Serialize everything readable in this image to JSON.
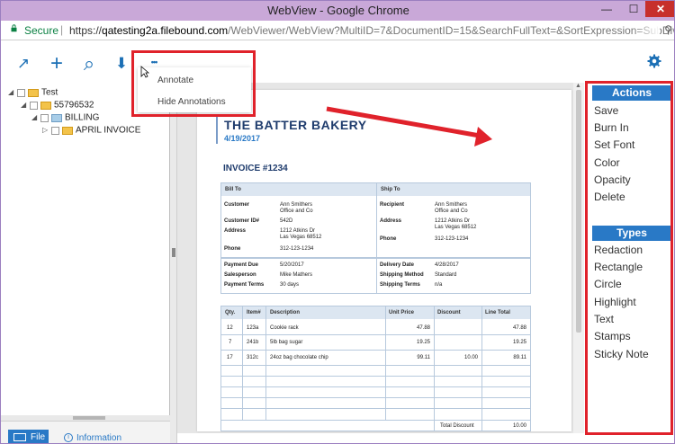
{
  "window": {
    "title": "WebView - Google Chrome",
    "controls": {
      "minimize": "—",
      "maximize": "☐",
      "close": "✕"
    }
  },
  "address_bar": {
    "secure_label": "Secure",
    "separator": "|",
    "url_scheme": "https://",
    "url_host": "qatesting2a.filebound.com",
    "url_path": "/WebViewer/WebView?MultiID=7&DocumentID=15&SearchFullText=&SortExpression=SubDivic"
  },
  "toolbar": {
    "icons": [
      "share-icon",
      "add-icon",
      "search-icon",
      "download-icon",
      "more-icon",
      "gear-icon"
    ],
    "glyphs": {
      "share": "↗",
      "add": "+",
      "search": "⌕",
      "download": "⬇",
      "more": "•••"
    }
  },
  "more_menu": {
    "items": [
      "Annotate",
      "Hide Annotations"
    ]
  },
  "tree": {
    "nodes": [
      {
        "label": "Test",
        "level": 0,
        "folder": "yellow"
      },
      {
        "label": "55796532",
        "level": 1,
        "folder": "yellow"
      },
      {
        "label": "BILLING",
        "level": 2,
        "folder": "blue"
      },
      {
        "label": "APRIL INVOICE",
        "level": 3,
        "folder": "yellow"
      }
    ]
  },
  "bottom_tabs": {
    "file": "File",
    "information": "Information"
  },
  "document": {
    "company": "THE BATTER BAKERY",
    "date": "4/19/2017",
    "invoice_no": "INVOICE #1234",
    "bill_to": {
      "header": "Bill To",
      "customer_label": "Customer",
      "customer": "Ann Smithers\nOffice and Co",
      "customer_id_label": "Customer ID#",
      "customer_id": "542D",
      "address_label": "Address",
      "address": "1212 Atkins Dr\nLas Vegas 68512",
      "phone_label": "Phone",
      "phone": "312-123-1234"
    },
    "ship_to": {
      "header": "Ship To",
      "recipient_label": "Recipient",
      "recipient": "Ann Smithers\nOffice and Co",
      "address_label": "Address",
      "address": "1212 Atkins Dr\nLas Vegas 68512",
      "phone_label": "Phone",
      "phone": "312-123-1234"
    },
    "terms_left": {
      "payment_due_label": "Payment Due",
      "payment_due": "5/20/2017",
      "salesperson_label": "Salesperson",
      "salesperson": "Mike Mathers",
      "payment_terms_label": "Payment Terms",
      "payment_terms": "30 days"
    },
    "terms_right": {
      "delivery_date_label": "Delivery Date",
      "delivery_date": "4/28/2017",
      "shipping_method_label": "Shipping Method",
      "shipping_method": "Standard",
      "shipping_terms_label": "Shipping Terms",
      "shipping_terms": "n/a"
    },
    "items_table": {
      "headers": [
        "Qty.",
        "Item#",
        "Description",
        "Unit Price",
        "Discount",
        "Line Total"
      ],
      "rows": [
        [
          "12",
          "123a",
          "Cookie rack",
          "47.88",
          "",
          "47.88"
        ],
        [
          "7",
          "241b",
          "5lb bag sugar",
          "19.25",
          "",
          "19.25"
        ],
        [
          "17",
          "312c",
          "24oz bag chocolate chip",
          "99.11",
          "10.00",
          "89.11"
        ]
      ],
      "total_discount_label": "Total Discount",
      "total_discount": "10.00"
    }
  },
  "actions_panel": {
    "actions_header": "Actions",
    "actions": [
      "Save",
      "Burn In",
      "Set Font",
      "Color",
      "Opacity",
      "Delete"
    ],
    "types_header": "Types",
    "types": [
      "Redaction",
      "Rectangle",
      "Circle",
      "Highlight",
      "Text",
      "Stamps",
      "Sticky Note"
    ]
  },
  "colors": {
    "accent": "#2979c6",
    "highlight_box": "#e0222b",
    "title_bar": "#c9a8d8",
    "table_header": "#dce6f1"
  }
}
